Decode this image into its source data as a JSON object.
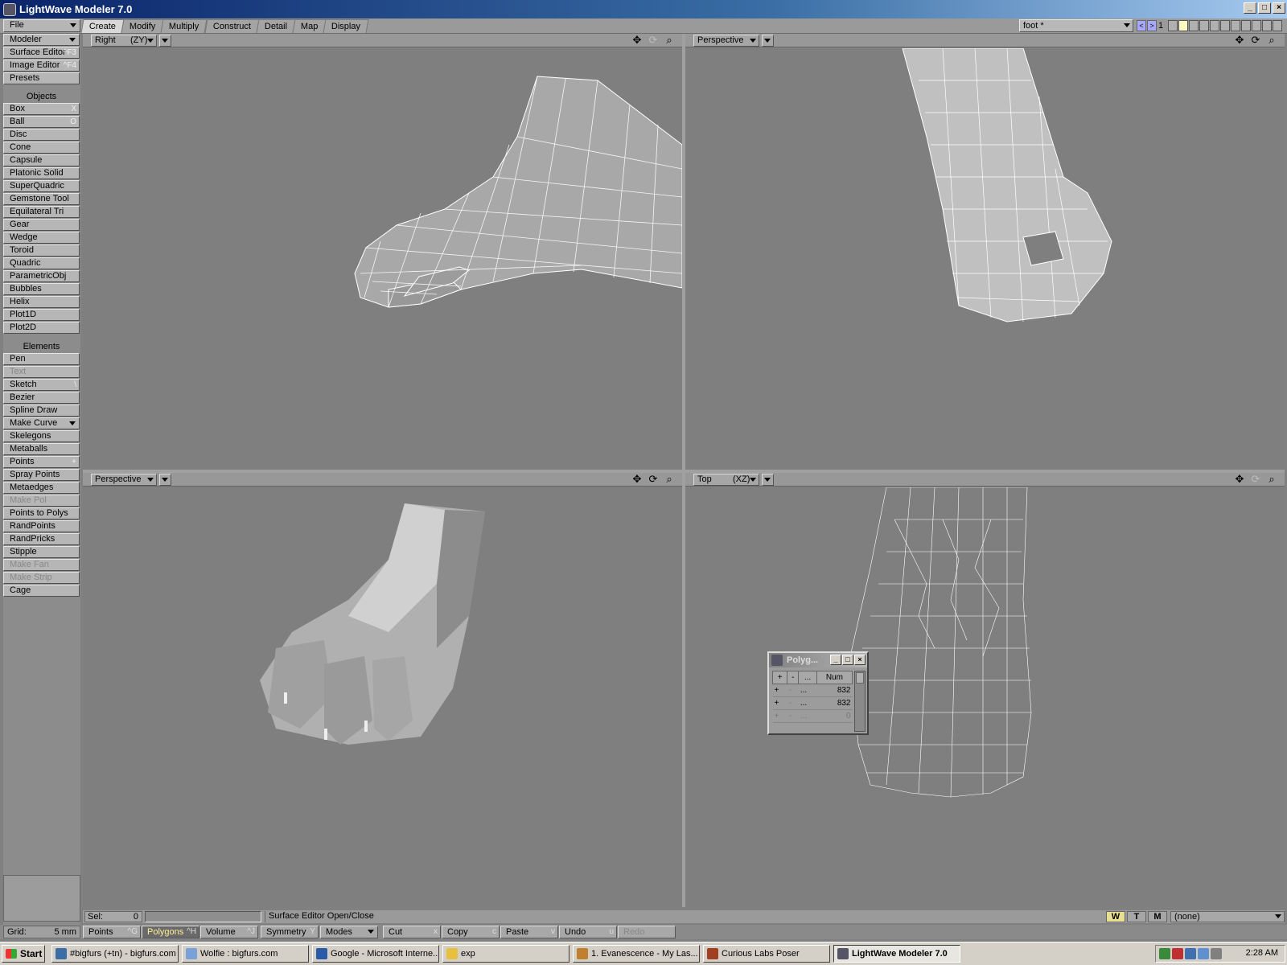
{
  "window": {
    "title": "LightWave Modeler 7.0",
    "controls": [
      "_",
      "□",
      "×"
    ]
  },
  "menu": {
    "file": "File",
    "modeler": "Modeler",
    "surface_editor": "Surface Editor",
    "surface_editor_shortcut": "^F3",
    "image_editor": "Image Editor",
    "image_editor_shortcut": "^F4",
    "presets": "Presets"
  },
  "tabs": [
    "Create",
    "Modify",
    "Multiply",
    "Construct",
    "Detail",
    "Map",
    "Display"
  ],
  "active_tab": "Create",
  "layer": {
    "object_name": "foot *",
    "nav_prev": "<",
    "nav_next": ">",
    "current_layer": "1"
  },
  "toolbar": {
    "objects_header": "Objects",
    "objects": [
      {
        "label": "Box",
        "shortcut": "X"
      },
      {
        "label": "Ball",
        "shortcut": "O"
      },
      {
        "label": "Disc",
        "shortcut": ""
      },
      {
        "label": "Cone",
        "shortcut": ""
      },
      {
        "label": "Capsule",
        "shortcut": ""
      },
      {
        "label": "Platonic Solid",
        "shortcut": ""
      },
      {
        "label": "SuperQuadric",
        "shortcut": ""
      },
      {
        "label": "Gemstone Tool",
        "shortcut": ""
      },
      {
        "label": "Equilateral Tri",
        "shortcut": ""
      },
      {
        "label": "Gear",
        "shortcut": ""
      },
      {
        "label": "Wedge",
        "shortcut": ""
      },
      {
        "label": "Toroid",
        "shortcut": ""
      },
      {
        "label": "Quadric",
        "shortcut": ""
      },
      {
        "label": "ParametricObj",
        "shortcut": ""
      },
      {
        "label": "Bubbles",
        "shortcut": ""
      },
      {
        "label": "Helix",
        "shortcut": ""
      },
      {
        "label": "Plot1D",
        "shortcut": ""
      },
      {
        "label": "Plot2D",
        "shortcut": ""
      }
    ],
    "elements_header": "Elements",
    "elements": [
      {
        "label": "Pen",
        "shortcut": "",
        "disabled": false
      },
      {
        "label": "Text",
        "shortcut": "",
        "disabled": true
      },
      {
        "label": "Sketch",
        "shortcut": "\\",
        "disabled": false
      },
      {
        "label": "Bezier",
        "shortcut": "",
        "disabled": false
      },
      {
        "label": "Spline Draw",
        "shortcut": "",
        "disabled": false
      },
      {
        "label": "Make Curve",
        "shortcut": "",
        "disabled": false,
        "dropdown": true
      },
      {
        "label": "Skelegons",
        "shortcut": "",
        "disabled": false
      },
      {
        "label": "Metaballs",
        "shortcut": "",
        "disabled": false
      },
      {
        "label": "Points",
        "shortcut": "+",
        "disabled": false
      },
      {
        "label": "Spray Points",
        "shortcut": "",
        "disabled": false
      },
      {
        "label": "Metaedges",
        "shortcut": "",
        "disabled": false
      },
      {
        "label": "Make Pol",
        "shortcut": "",
        "disabled": true
      },
      {
        "label": "Points to Polys",
        "shortcut": "",
        "disabled": false
      },
      {
        "label": "RandPoints",
        "shortcut": "",
        "disabled": false
      },
      {
        "label": "RandPricks",
        "shortcut": "",
        "disabled": false
      },
      {
        "label": "Stipple",
        "shortcut": "",
        "disabled": false
      },
      {
        "label": "Make Fan",
        "shortcut": "",
        "disabled": true
      },
      {
        "label": "Make Strip",
        "shortcut": "",
        "disabled": true
      },
      {
        "label": "Cage",
        "shortcut": "",
        "disabled": false
      }
    ]
  },
  "viewports": {
    "top_left": {
      "view": "Right",
      "axis": "(ZY)"
    },
    "top_right": {
      "view": "Perspective",
      "axis": ""
    },
    "bottom_left": {
      "view": "Perspective",
      "axis": ""
    },
    "bottom_right": {
      "view": "Top",
      "axis": "(XZ)"
    }
  },
  "poly_stats": {
    "title": "Polyg...",
    "col_plus": "+",
    "col_minus": "-",
    "col_dots": "...",
    "col_num": "Num",
    "rows": [
      {
        "plus": "+",
        "minus": "-",
        "label": "...",
        "num": "832"
      },
      {
        "plus": "+",
        "minus": "-",
        "label": "...",
        "num": "832"
      },
      {
        "plus": "+",
        "minus": "-",
        "label": "...",
        "num": "0"
      }
    ]
  },
  "status": {
    "sel_label": "Sel:",
    "sel_value": "0",
    "help_text": "Surface Editor Open/Close",
    "w": "W",
    "t": "T",
    "m": "M",
    "surface": "(none)"
  },
  "bottombar": {
    "grid_label": "Grid:",
    "grid_value": "5 mm",
    "points": "Points",
    "points_shortcut": "^G",
    "polygons": "Polygons",
    "polygons_shortcut": "^H",
    "volume": "Volume",
    "volume_shortcut": "^J",
    "symmetry": "Symmetry",
    "symmetry_shortcut": "Y",
    "modes": "Modes",
    "cut": "Cut",
    "cut_shortcut": "x",
    "copy": "Copy",
    "copy_shortcut": "c",
    "paste": "Paste",
    "paste_shortcut": "v",
    "undo": "Undo",
    "undo_shortcut": "u",
    "redo": "Redo"
  },
  "taskbar": {
    "start": "Start",
    "tasks": [
      {
        "label": "#bigfurs (+tn) - bigfurs.com",
        "color": "#3a6ea5"
      },
      {
        "label": "Wolfie : bigfurs.com",
        "color": "#7aa0d8"
      },
      {
        "label": "Google - Microsoft Interne...",
        "color": "#2a5aa8"
      },
      {
        "label": "exp",
        "color": "#e8c040"
      },
      {
        "label": "1. Evanescence - My Las...",
        "color": "#c08030"
      },
      {
        "label": "Curious Labs Poser",
        "color": "#a04020"
      },
      {
        "label": "LightWave Modeler 7.0",
        "color": "#556"
      }
    ],
    "clock": "2:28 AM"
  }
}
